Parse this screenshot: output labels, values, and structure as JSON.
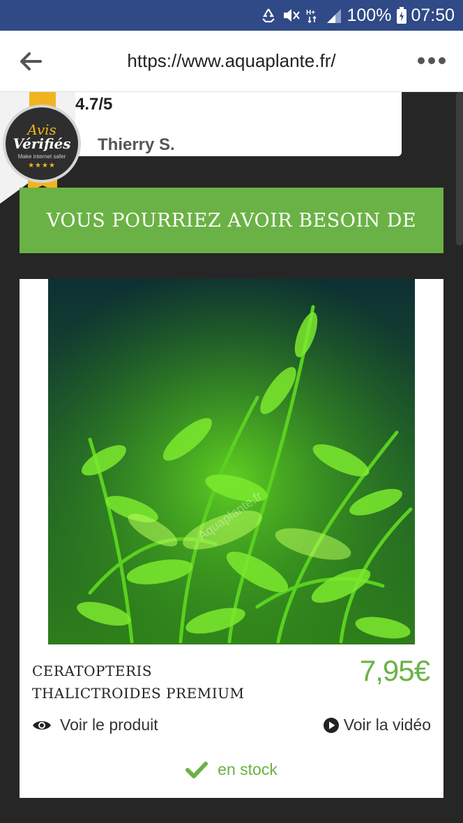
{
  "statusbar": {
    "battery": "100%",
    "time": "07:50",
    "icons": [
      "recycle-icon",
      "mute-icon",
      "network-hplus-icon",
      "signal-icon",
      "battery-icon"
    ]
  },
  "browser": {
    "url": "https://www.aquaplante.fr/",
    "icons": [
      "back-arrow-icon",
      "more-icon"
    ]
  },
  "review": {
    "rating": "4.7/5",
    "reviewer": "Thierry S.",
    "badge": {
      "line1": "Avis",
      "line2": "Vérifiés",
      "line3": "Make internet safer",
      "stars": "★★★★"
    }
  },
  "banner": {
    "title": "VOUS POURRIEZ AVOIR BESOIN DE"
  },
  "product": {
    "name_line1": "CERATOPTERIS",
    "name_line2": "THALICTROIDES PREMIUM",
    "price": "7,95€",
    "image_watermark": "Aquaplante.fr",
    "view_product_label": "Voir le produit",
    "view_video_label": "Voir la vidéo",
    "stock_label": "en stock",
    "icons": [
      "eye-icon",
      "play-icon",
      "check-icon"
    ]
  },
  "colors": {
    "statusbar": "#2f4a86",
    "accent_green": "#6ab245",
    "background": "#262626",
    "badge_gold": "#f1b41f"
  }
}
